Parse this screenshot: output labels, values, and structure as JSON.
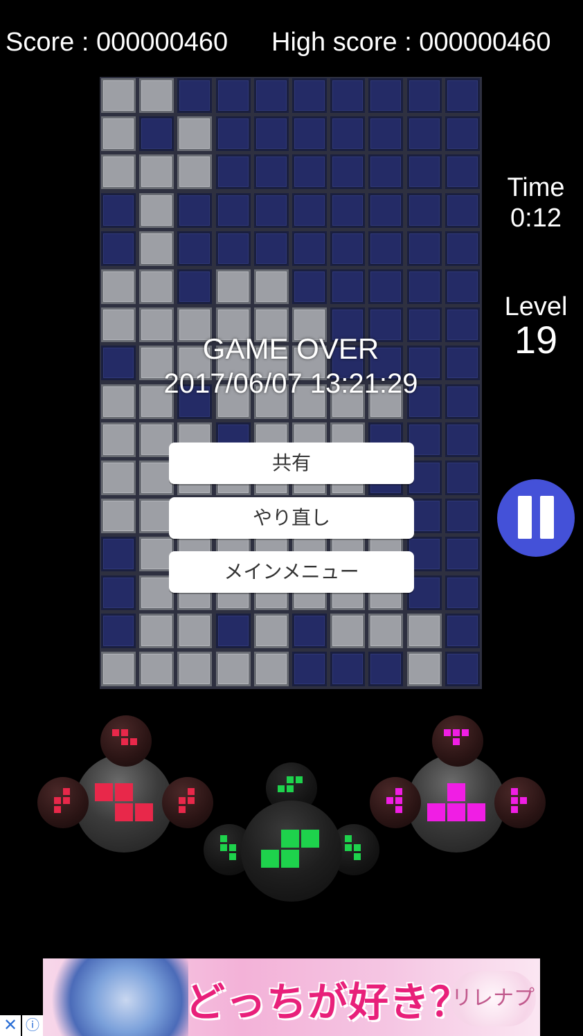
{
  "header": {
    "score_text": "Score : 000000460",
    "highscore_text": "High score : 000000460"
  },
  "board": {
    "rows": [
      "LLDDDDDDDD",
      "LDLDDDDDDD",
      "LLLDDDDDDD",
      "DLDDDDDDDD",
      "DLDDDDDDDD",
      "LLDLLDDDDD",
      "LLLLLLDDDD",
      "DLLLLLDDDD",
      "LLDLLLLLDD",
      "LLLDLLLDDD",
      "LLLLLLLDDD",
      "LLLLLLLLDD",
      "DLLLLLLLDD",
      "DLLLLLLLDD",
      "DLLDLDLLLD",
      "LLLLLDDDLD"
    ],
    "colors": {
      "dark": "#242b66",
      "light": "#9d9fa5"
    }
  },
  "game_over": {
    "title": "GAME OVER",
    "datetime": "2017/06/07 13:21:29",
    "buttons": {
      "share": "共有",
      "retry": "やり直し",
      "main_menu": "メインメニュー"
    }
  },
  "sidebar": {
    "time_label": "Time",
    "time_value": "0:12",
    "level_label": "Level",
    "level_value": "19",
    "pause_icon": "pause-icon",
    "pause_color": "#4451d8"
  },
  "controls": {
    "red": {
      "color": "#e8284a",
      "piece": "z-tetromino",
      "icon": "rotate-left-piece"
    },
    "green": {
      "color": "#1ed24c",
      "piece": "s-tetromino",
      "icon": "drop-piece"
    },
    "magenta": {
      "color": "#f01ee4",
      "piece": "t-tetromino",
      "icon": "rotate-right-piece"
    }
  },
  "ad": {
    "headline": "どっちが好き？",
    "logo_text": "リレナプリ",
    "close_icon": "close-icon",
    "info_icon": "info-icon"
  }
}
